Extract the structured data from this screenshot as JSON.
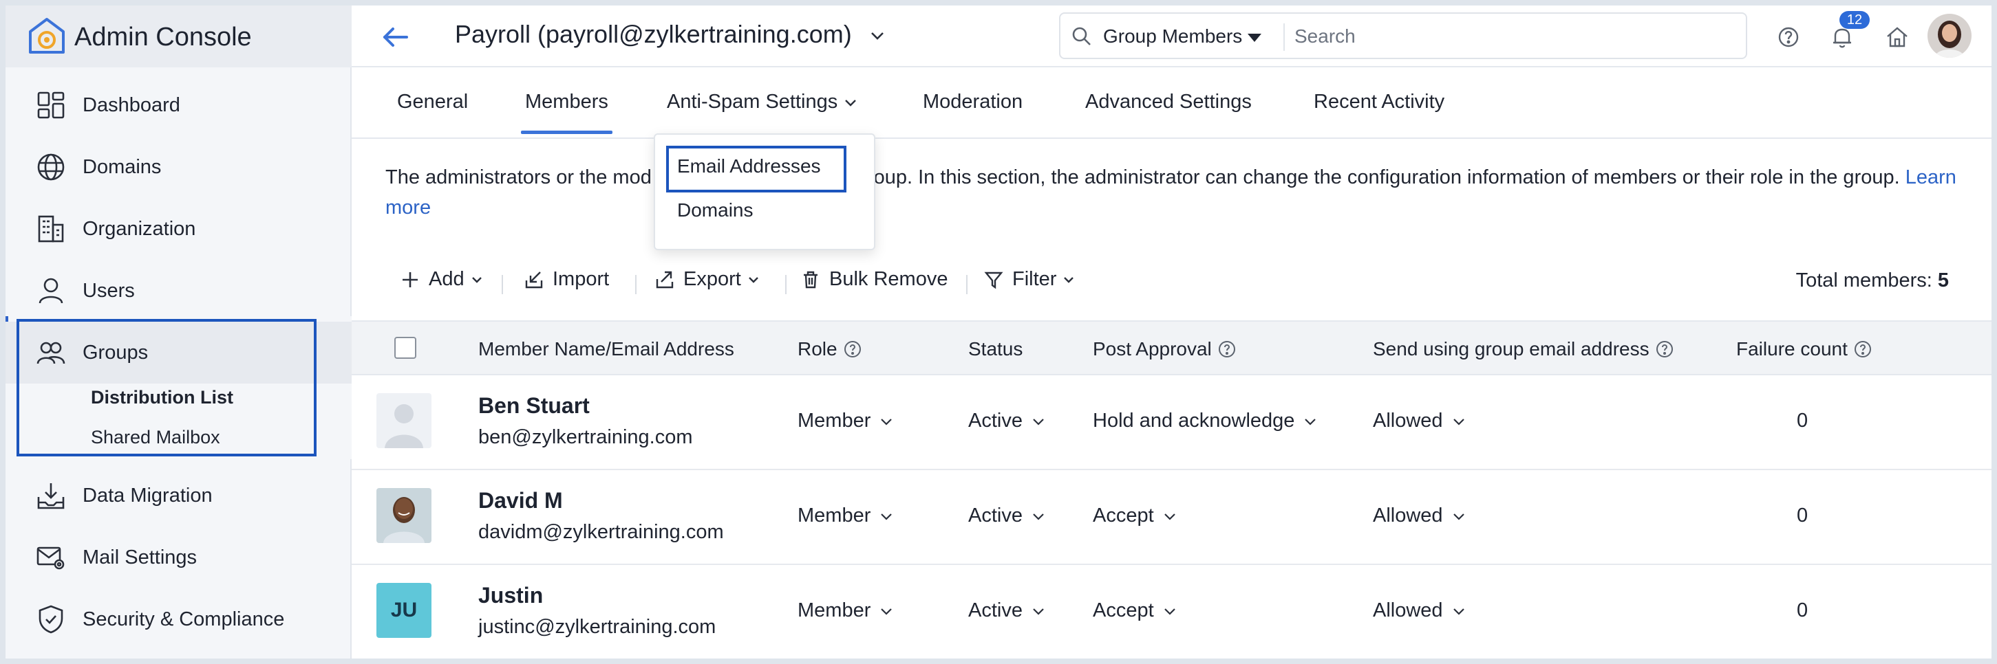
{
  "app": {
    "title": "Admin Console"
  },
  "sidebar": {
    "items": [
      {
        "label": "Dashboard",
        "icon": "dashboard-icon"
      },
      {
        "label": "Domains",
        "icon": "globe-icon"
      },
      {
        "label": "Organization",
        "icon": "building-icon"
      },
      {
        "label": "Users",
        "icon": "user-icon"
      },
      {
        "label": "Groups",
        "icon": "groups-icon"
      },
      {
        "label": "Data Migration",
        "icon": "download-tray-icon"
      },
      {
        "label": "Mail Settings",
        "icon": "mail-settings-icon"
      },
      {
        "label": "Security & Compliance",
        "icon": "shield-icon"
      }
    ],
    "groups_sub": [
      {
        "label": "Distribution List",
        "selected": true
      },
      {
        "label": "Shared Mailbox",
        "selected": false
      }
    ]
  },
  "header": {
    "group_title": "Payroll (payroll@zylkertraining.com)",
    "search_scope": "Group Members",
    "search_placeholder": "Search",
    "notification_count": "12"
  },
  "tabs": [
    {
      "label": "General",
      "active": false
    },
    {
      "label": "Members",
      "active": true
    },
    {
      "label": "Anti-Spam Settings",
      "active": false,
      "has_dropdown": true
    },
    {
      "label": "Moderation",
      "active": false
    },
    {
      "label": "Advanced Settings",
      "active": false
    },
    {
      "label": "Recent Activity",
      "active": false
    }
  ],
  "antispam_dropdown": {
    "items": [
      "Email Addresses",
      "Domains"
    ],
    "highlighted": "Email Addresses"
  },
  "description": {
    "part1": "The administrators or the mod",
    "part2": "ers to the group. In this section, the administrator can change the configuration information of members or their role in the group.",
    "learn_more": "Learn more"
  },
  "toolbar": {
    "add": "Add",
    "import": "Import",
    "export": "Export",
    "bulk_remove": "Bulk Remove",
    "filter": "Filter",
    "total_label": "Total members:",
    "total_value": "5"
  },
  "table": {
    "columns": [
      "Member Name/Email Address",
      "Role",
      "Status",
      "Post Approval",
      "Send using group email address",
      "Failure count"
    ],
    "rows": [
      {
        "name": "Ben Stuart",
        "email": "ben@zylkertraining.com",
        "avatar": "placeholder",
        "role": "Member",
        "status": "Active",
        "post_approval": "Hold and acknowledge",
        "send_using_group": "Allowed",
        "failure_count": "0"
      },
      {
        "name": "David M",
        "email": "davidm@zylkertraining.com",
        "avatar": "photo",
        "role": "Member",
        "status": "Active",
        "post_approval": "Accept",
        "send_using_group": "Allowed",
        "failure_count": "0"
      },
      {
        "name": "Justin",
        "email": "justinc@zylkertraining.com",
        "avatar": "initials",
        "initials": "JU",
        "role": "Member",
        "status": "Active",
        "post_approval": "Accept",
        "send_using_group": "Allowed",
        "failure_count": "0"
      }
    ]
  },
  "colors": {
    "accent": "#3b73d9",
    "highlight_box": "#1c55bd",
    "badge": "#2d6bd8",
    "initials_bg": "#5fc7d9"
  }
}
